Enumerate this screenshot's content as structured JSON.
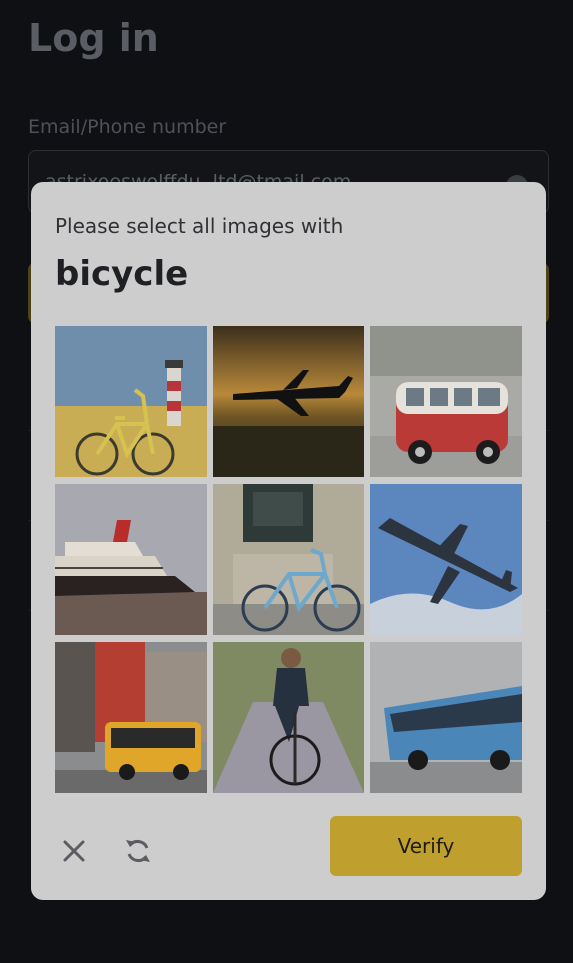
{
  "background": {
    "title": "Log in",
    "email_label": "Email/Phone number",
    "email_value": "astrixoeswolffdu..ltd@tmail.com"
  },
  "captcha": {
    "prompt": "Please select all images with",
    "target": "bicycle",
    "verify_label": "Verify",
    "tiles": [
      {
        "name": "tile-bicycle-lighthouse",
        "icon": "bicycle"
      },
      {
        "name": "tile-airplane-sunset",
        "icon": "airplane"
      },
      {
        "name": "tile-red-van",
        "icon": "van"
      },
      {
        "name": "tile-cruise-ship",
        "icon": "ship"
      },
      {
        "name": "tile-bicycle-storefront",
        "icon": "bicycle"
      },
      {
        "name": "tile-airplane-sky",
        "icon": "airplane"
      },
      {
        "name": "tile-yellow-bus",
        "icon": "bus"
      },
      {
        "name": "tile-cyclist",
        "icon": "bicycle"
      },
      {
        "name": "tile-blue-bus",
        "icon": "bus"
      }
    ],
    "colors": {
      "panel": "#cdcdcd",
      "verify": "#bf9f2e"
    }
  }
}
